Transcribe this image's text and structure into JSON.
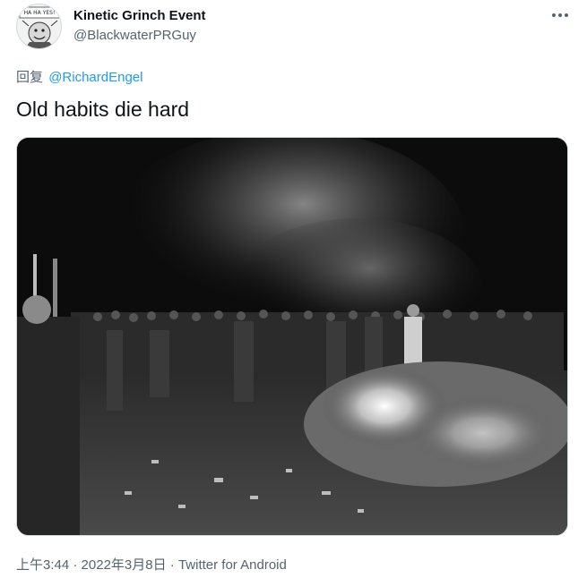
{
  "tweet": {
    "author_name": "Kinetic Grinch Event",
    "author_handle": "@BlackwaterPRGuy",
    "reply_prefix": "回复",
    "reply_to": "@RichardEngel",
    "text": "Old habits die hard",
    "time": "上午3:44",
    "separator": "·",
    "date": "2022年3月8日",
    "source": "Twitter for Android"
  },
  "avatar": {
    "icon": "cartoon-avatar-icon",
    "caption_text": "HA HA HA YES!"
  },
  "icons": {
    "more": "more-dots-icon",
    "media": "photo-book-burning"
  },
  "colors": {
    "link": "#1d9bf0",
    "secondary_text": "#536471",
    "primary_text": "#0f1419",
    "border": "#cfd9de"
  }
}
